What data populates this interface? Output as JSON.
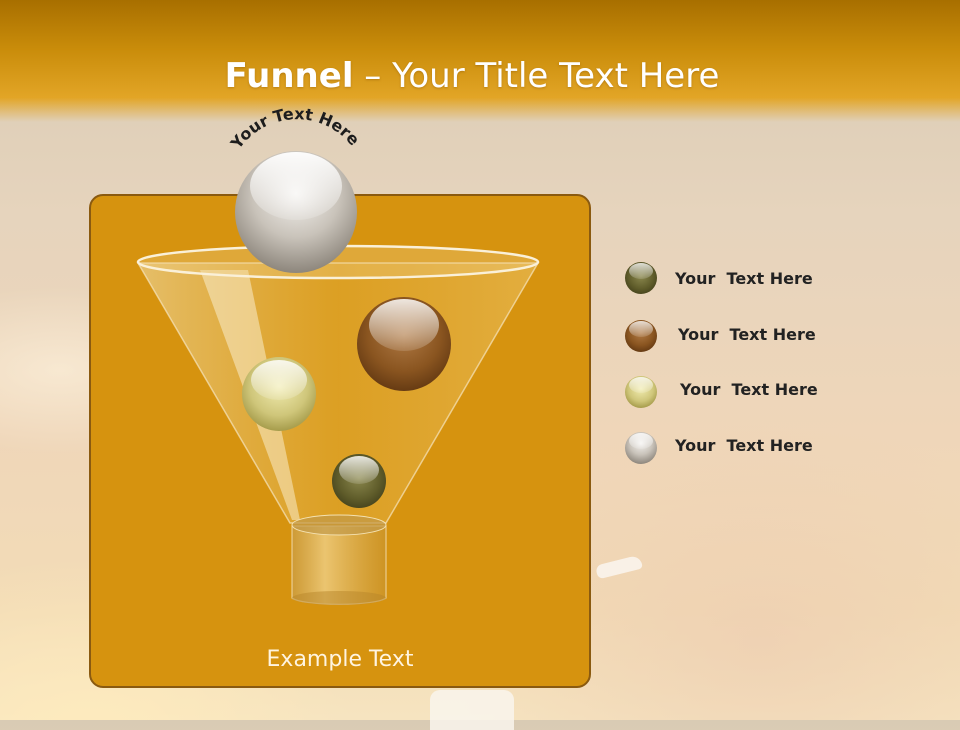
{
  "slide": {
    "title_bold": "Funnel",
    "title_rest": " – Your Title Text Here",
    "arc_text": "Your Text Here",
    "example_text": "Example Text"
  },
  "legend": [
    {
      "label": "Your  Text Here",
      "color": "#5f5c2a"
    },
    {
      "label": "Your  Text Here",
      "color": "#8a5520"
    },
    {
      "label": "Your  Text Here",
      "color": "#c9c56a"
    },
    {
      "label": "Your  Text Here",
      "color": "#a7a39c"
    }
  ],
  "colors": {
    "header": "#c98c0a",
    "panel": "#d6930f",
    "panel_border": "#8a5a10"
  }
}
